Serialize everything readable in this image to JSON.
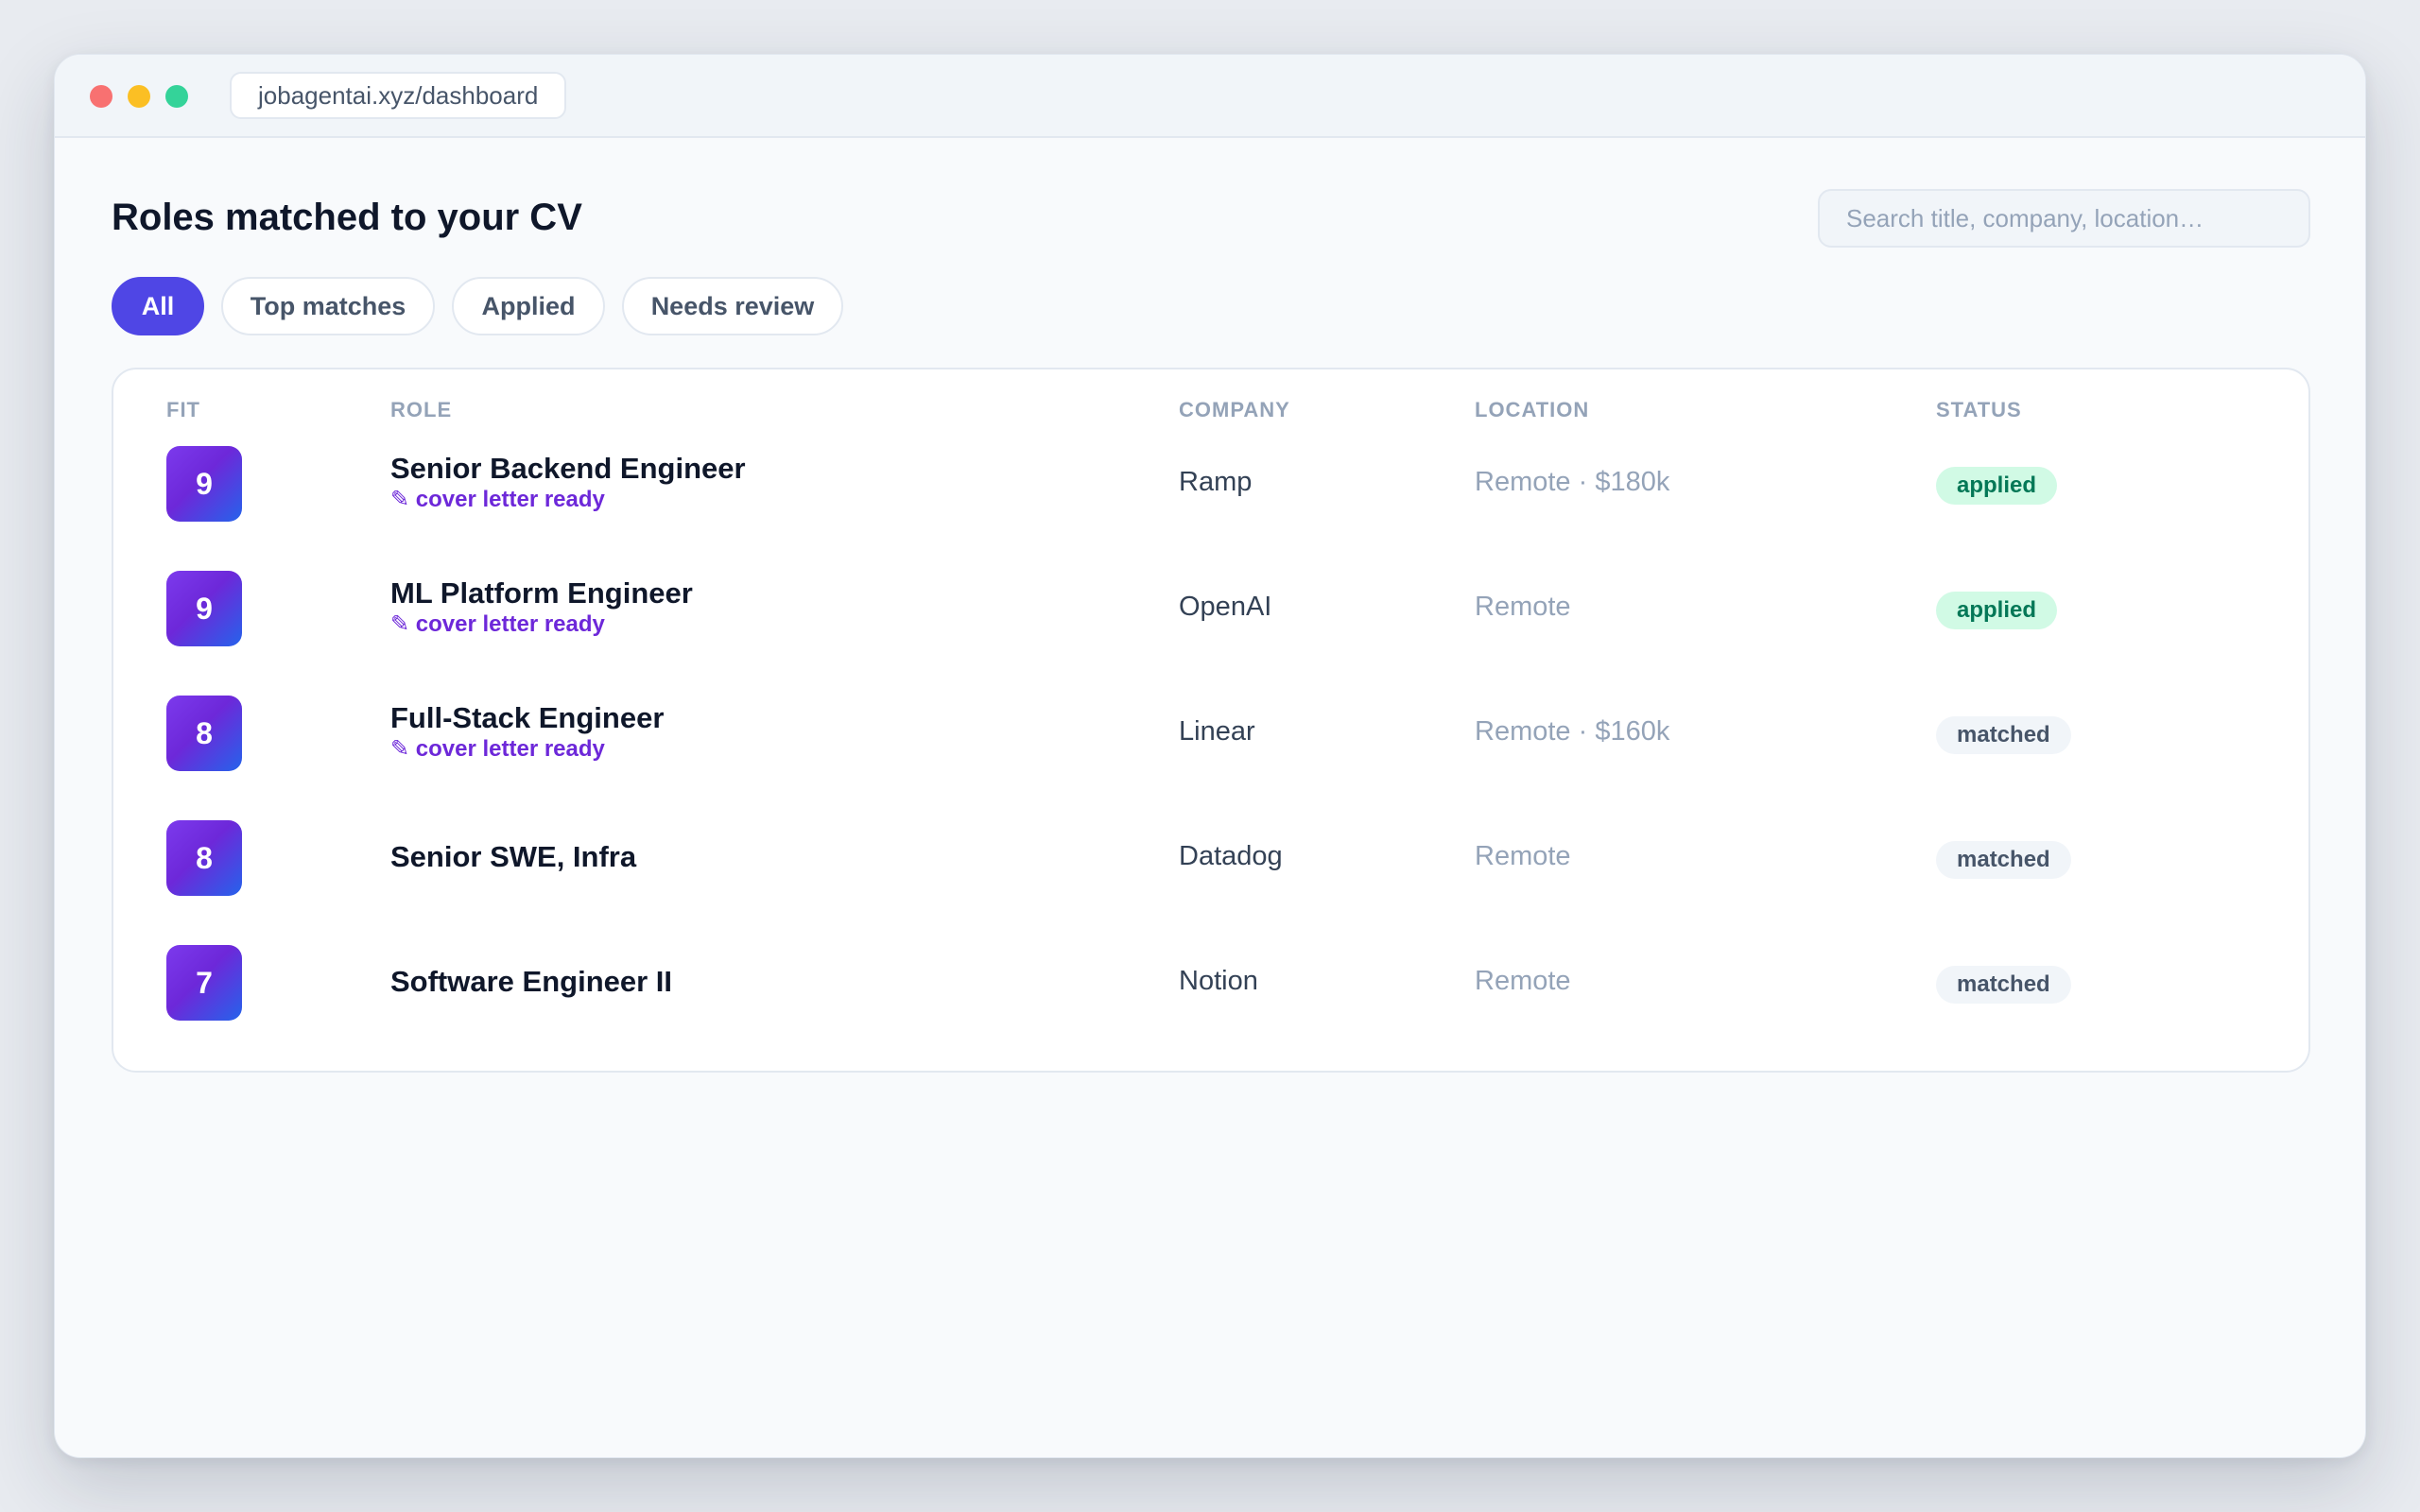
{
  "browser": {
    "url": "jobagentai.xyz/dashboard"
  },
  "page": {
    "title": "Roles matched to your CV"
  },
  "search": {
    "placeholder": "Search title, company, location…",
    "value": ""
  },
  "filters": [
    {
      "label": "All",
      "active": true
    },
    {
      "label": "Top matches",
      "active": false
    },
    {
      "label": "Applied",
      "active": false
    },
    {
      "label": "Needs review",
      "active": false
    }
  ],
  "table": {
    "columns": {
      "fit": "FIT",
      "role": "ROLE",
      "company": "COMPANY",
      "location": "LOCATION",
      "status": "STATUS"
    },
    "rows": [
      {
        "fit": "9",
        "role": "Senior Backend Engineer",
        "note": "✎ cover letter ready",
        "company": "Ramp",
        "location": "Remote · $180k",
        "status": "applied"
      },
      {
        "fit": "9",
        "role": "ML Platform Engineer",
        "note": "✎ cover letter ready",
        "company": "OpenAI",
        "location": "Remote",
        "status": "applied"
      },
      {
        "fit": "8",
        "role": "Full-Stack Engineer",
        "note": "✎ cover letter ready",
        "company": "Linear",
        "location": "Remote · $160k",
        "status": "matched"
      },
      {
        "fit": "8",
        "role": "Senior SWE, Infra",
        "note": "",
        "company": "Datadog",
        "location": "Remote",
        "status": "matched"
      },
      {
        "fit": "7",
        "role": "Software Engineer II",
        "note": "",
        "company": "Notion",
        "location": "Remote",
        "status": "matched"
      }
    ]
  },
  "colors": {
    "accent": "#4f46e5",
    "note": "#6d28d9",
    "applied_bg": "#d1fae5",
    "applied_text": "#047857",
    "matched_bg": "#f1f5f9",
    "matched_text": "#475569"
  }
}
